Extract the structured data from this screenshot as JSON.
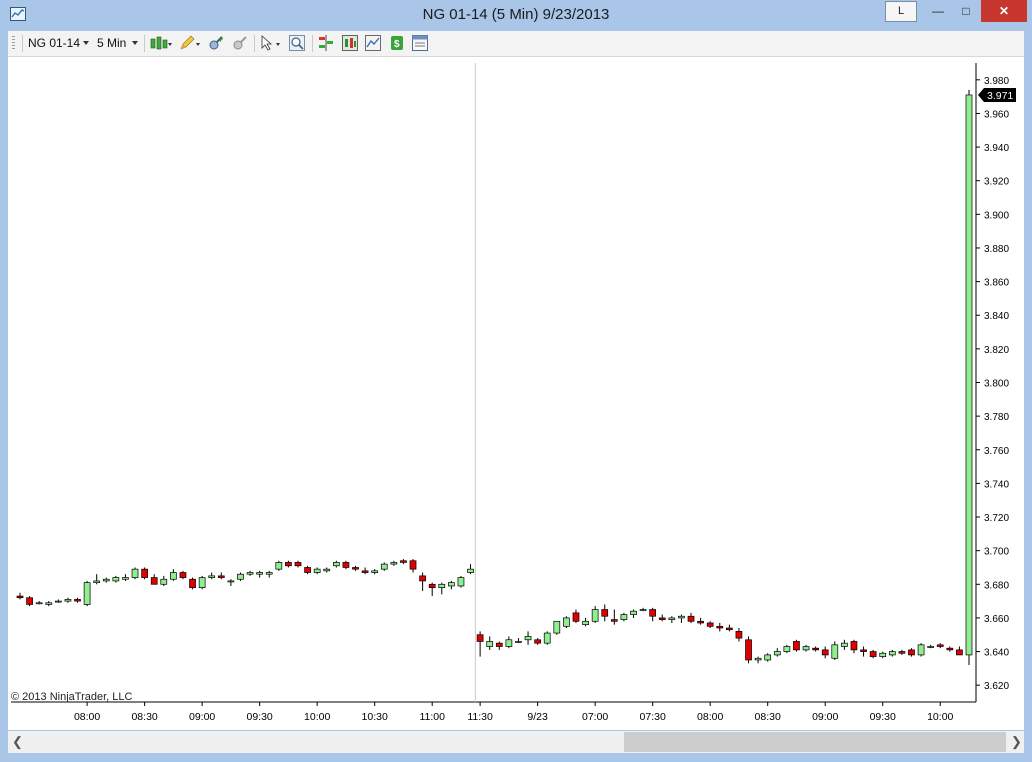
{
  "window": {
    "title": "NG 01-14 (5 Min)  9/23/2013",
    "l_button": "L",
    "min_glyph": "—",
    "max_glyph": "□",
    "close_glyph": "✕"
  },
  "toolbar": {
    "instrument": "NG 01-14",
    "interval": "5 Min",
    "icons": [
      "bar-type-icon",
      "drawing-pencil-icon",
      "zoom-in-icon",
      "zoom-out-icon",
      "cursor-icon",
      "magnifier-icon",
      "strategies-icon",
      "indicators-icon",
      "chart-properties-icon",
      "dollar-icon",
      "data-box-icon"
    ]
  },
  "copyright": "© 2013 NinjaTrader, LLC",
  "price_marker": "3.971",
  "colors": {
    "up": "#90ee90",
    "down": "#e00000",
    "wick": "#000000",
    "close_btn": "#c7372f",
    "frame": "#a9c6e8"
  },
  "chart_data": {
    "type": "candlestick",
    "ylim": [
      3.61,
      3.99
    ],
    "y_ticks": [
      "3.980",
      "3.960",
      "3.940",
      "3.920",
      "3.900",
      "3.880",
      "3.860",
      "3.840",
      "3.820",
      "3.800",
      "3.780",
      "3.760",
      "3.740",
      "3.720",
      "3.700",
      "3.680",
      "3.660",
      "3.640",
      "3.620"
    ],
    "x_labels": [
      "08:00",
      "08:30",
      "09:00",
      "09:30",
      "10:00",
      "10:30",
      "11:00",
      "11:30",
      "9/23",
      "07:00",
      "07:30",
      "08:00",
      "08:30",
      "09:00",
      "09:30",
      "10:00"
    ],
    "session_break_after_index": 47,
    "candles": [
      [
        3.673,
        3.675,
        3.671,
        3.672
      ],
      [
        3.672,
        3.673,
        3.667,
        3.668
      ],
      [
        3.669,
        3.67,
        3.668,
        3.669
      ],
      [
        3.668,
        3.67,
        3.667,
        3.669
      ],
      [
        3.67,
        3.671,
        3.669,
        3.67
      ],
      [
        3.67,
        3.672,
        3.669,
        3.671
      ],
      [
        3.671,
        3.672,
        3.669,
        3.67
      ],
      [
        3.668,
        3.682,
        3.667,
        3.681
      ],
      [
        3.681,
        3.686,
        3.68,
        3.682
      ],
      [
        3.682,
        3.684,
        3.681,
        3.683
      ],
      [
        3.682,
        3.685,
        3.681,
        3.684
      ],
      [
        3.683,
        3.686,
        3.682,
        3.684
      ],
      [
        3.684,
        3.69,
        3.683,
        3.689
      ],
      [
        3.689,
        3.69,
        3.683,
        3.684
      ],
      [
        3.684,
        3.686,
        3.68,
        3.68
      ],
      [
        3.68,
        3.685,
        3.679,
        3.683
      ],
      [
        3.683,
        3.689,
        3.682,
        3.687
      ],
      [
        3.687,
        3.688,
        3.683,
        3.684
      ],
      [
        3.683,
        3.684,
        3.677,
        3.678
      ],
      [
        3.678,
        3.685,
        3.677,
        3.684
      ],
      [
        3.684,
        3.687,
        3.683,
        3.685
      ],
      [
        3.685,
        3.687,
        3.683,
        3.684
      ],
      [
        3.682,
        3.683,
        3.679,
        3.682
      ],
      [
        3.683,
        3.687,
        3.682,
        3.686
      ],
      [
        3.686,
        3.688,
        3.685,
        3.687
      ],
      [
        3.686,
        3.688,
        3.684,
        3.687
      ],
      [
        3.686,
        3.688,
        3.684,
        3.687
      ],
      [
        3.689,
        3.694,
        3.688,
        3.693
      ],
      [
        3.693,
        3.694,
        3.69,
        3.691
      ],
      [
        3.693,
        3.694,
        3.69,
        3.691
      ],
      [
        3.69,
        3.691,
        3.686,
        3.687
      ],
      [
        3.687,
        3.69,
        3.686,
        3.689
      ],
      [
        3.688,
        3.69,
        3.687,
        3.689
      ],
      [
        3.691,
        3.694,
        3.69,
        3.693
      ],
      [
        3.693,
        3.694,
        3.689,
        3.69
      ],
      [
        3.69,
        3.691,
        3.688,
        3.689
      ],
      [
        3.688,
        3.69,
        3.686,
        3.687
      ],
      [
        3.687,
        3.689,
        3.686,
        3.688
      ],
      [
        3.689,
        3.693,
        3.688,
        3.692
      ],
      [
        3.692,
        3.694,
        3.691,
        3.693
      ],
      [
        3.694,
        3.695,
        3.692,
        3.693
      ],
      [
        3.694,
        3.695,
        3.687,
        3.689
      ],
      [
        3.685,
        3.687,
        3.676,
        3.682
      ],
      [
        3.68,
        3.681,
        3.673,
        3.678
      ],
      [
        3.678,
        3.681,
        3.674,
        3.68
      ],
      [
        3.679,
        3.682,
        3.677,
        3.681
      ],
      [
        3.679,
        3.685,
        3.678,
        3.684
      ],
      [
        3.687,
        3.692,
        3.686,
        3.689
      ],
      [
        3.65,
        3.652,
        3.637,
        3.646
      ],
      [
        3.643,
        3.649,
        3.641,
        3.646
      ],
      [
        3.645,
        3.646,
        3.641,
        3.643
      ],
      [
        3.643,
        3.649,
        3.642,
        3.647
      ],
      [
        3.646,
        3.648,
        3.645,
        3.646
      ],
      [
        3.647,
        3.652,
        3.644,
        3.649
      ],
      [
        3.647,
        3.648,
        3.644,
        3.645
      ],
      [
        3.645,
        3.652,
        3.644,
        3.651
      ],
      [
        3.651,
        3.658,
        3.65,
        3.658
      ],
      [
        3.655,
        3.661,
        3.654,
        3.66
      ],
      [
        3.663,
        3.665,
        3.657,
        3.658
      ],
      [
        3.656,
        3.66,
        3.655,
        3.658
      ],
      [
        3.658,
        3.667,
        3.657,
        3.665
      ],
      [
        3.665,
        3.668,
        3.658,
        3.661
      ],
      [
        3.659,
        3.665,
        3.656,
        3.658
      ],
      [
        3.659,
        3.663,
        3.658,
        3.662
      ],
      [
        3.662,
        3.665,
        3.66,
        3.664
      ],
      [
        3.665,
        3.666,
        3.664,
        3.665
      ],
      [
        3.665,
        3.666,
        3.658,
        3.661
      ],
      [
        3.66,
        3.662,
        3.658,
        3.659
      ],
      [
        3.659,
        3.661,
        3.657,
        3.66
      ],
      [
        3.66,
        3.662,
        3.657,
        3.661
      ],
      [
        3.661,
        3.663,
        3.657,
        3.658
      ],
      [
        3.658,
        3.66,
        3.656,
        3.657
      ],
      [
        3.657,
        3.658,
        3.654,
        3.655
      ],
      [
        3.655,
        3.657,
        3.652,
        3.654
      ],
      [
        3.654,
        3.656,
        3.652,
        3.653
      ],
      [
        3.652,
        3.654,
        3.646,
        3.648
      ],
      [
        3.647,
        3.649,
        3.633,
        3.635
      ],
      [
        3.635,
        3.637,
        3.633,
        3.636
      ],
      [
        3.635,
        3.639,
        3.634,
        3.638
      ],
      [
        3.638,
        3.642,
        3.637,
        3.64
      ],
      [
        3.64,
        3.644,
        3.639,
        3.643
      ],
      [
        3.646,
        3.647,
        3.64,
        3.641
      ],
      [
        3.641,
        3.644,
        3.64,
        3.643
      ],
      [
        3.642,
        3.643,
        3.64,
        3.641
      ],
      [
        3.641,
        3.643,
        3.636,
        3.638
      ],
      [
        3.636,
        3.646,
        3.635,
        3.644
      ],
      [
        3.643,
        3.647,
        3.641,
        3.645
      ],
      [
        3.646,
        3.647,
        3.639,
        3.641
      ],
      [
        3.641,
        3.643,
        3.637,
        3.64
      ],
      [
        3.64,
        3.641,
        3.636,
        3.637
      ],
      [
        3.637,
        3.64,
        3.636,
        3.639
      ],
      [
        3.638,
        3.641,
        3.637,
        3.64
      ],
      [
        3.64,
        3.641,
        3.638,
        3.639
      ],
      [
        3.641,
        3.642,
        3.637,
        3.638
      ],
      [
        3.638,
        3.645,
        3.637,
        3.644
      ],
      [
        3.643,
        3.644,
        3.642,
        3.643
      ],
      [
        3.644,
        3.645,
        3.642,
        3.643
      ],
      [
        3.642,
        3.643,
        3.64,
        3.641
      ],
      [
        3.641,
        3.643,
        3.638,
        3.638
      ],
      [
        3.638,
        3.974,
        3.632,
        3.971
      ]
    ]
  }
}
